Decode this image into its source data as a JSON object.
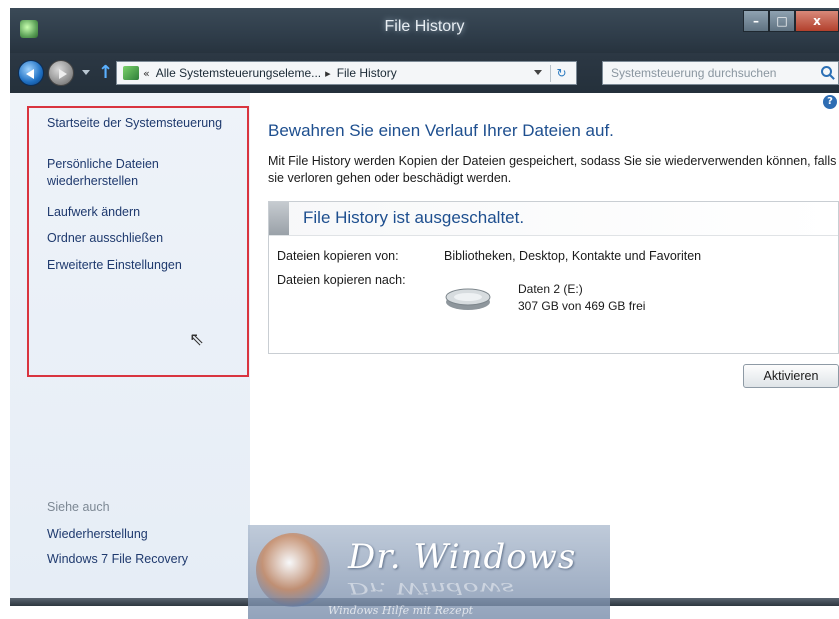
{
  "window": {
    "title": "File History",
    "controls": {
      "minimize": "–",
      "maximize": "□",
      "close": "x"
    }
  },
  "address_bar": {
    "prefix": "«",
    "segment_1": "Alle Systemsteuerungseleme...",
    "separator": "▸",
    "segment_2": "File History",
    "refresh_glyph": "↻"
  },
  "search": {
    "placeholder": "Systemsteuerung durchsuchen"
  },
  "sidebar": {
    "links": [
      "Startseite der Systemsteuerung",
      "Persönliche Dateien",
      "wiederherstellen",
      "Laufwerk ändern",
      "Ordner ausschließen",
      "Erweiterte Einstellungen"
    ],
    "see_also_heading": "Siehe auch",
    "see_also": [
      "Wiederherstellung",
      "Windows 7 File Recovery"
    ]
  },
  "main": {
    "help_glyph": "?",
    "title": "Bewahren Sie einen Verlauf Ihrer Dateien auf.",
    "description": "Mit File History werden Kopien der Dateien gespeichert, sodass Sie sie wiederverwenden können, falls sie verloren gehen oder beschädigt werden.",
    "status_title": "File History ist ausgeschaltet.",
    "copy_from_label": "Dateien kopieren von:",
    "copy_from_value": "Bibliotheken, Desktop, Kontakte und Favoriten",
    "copy_to_label": "Dateien kopieren nach:",
    "drive_name": "Daten 2 (E:)",
    "drive_space": "307 GB von 469 GB frei",
    "activate_button": "Aktivieren"
  },
  "watermark": {
    "brand": "Dr. Windows",
    "tagline": "Windows Hilfe mit Rezept"
  }
}
